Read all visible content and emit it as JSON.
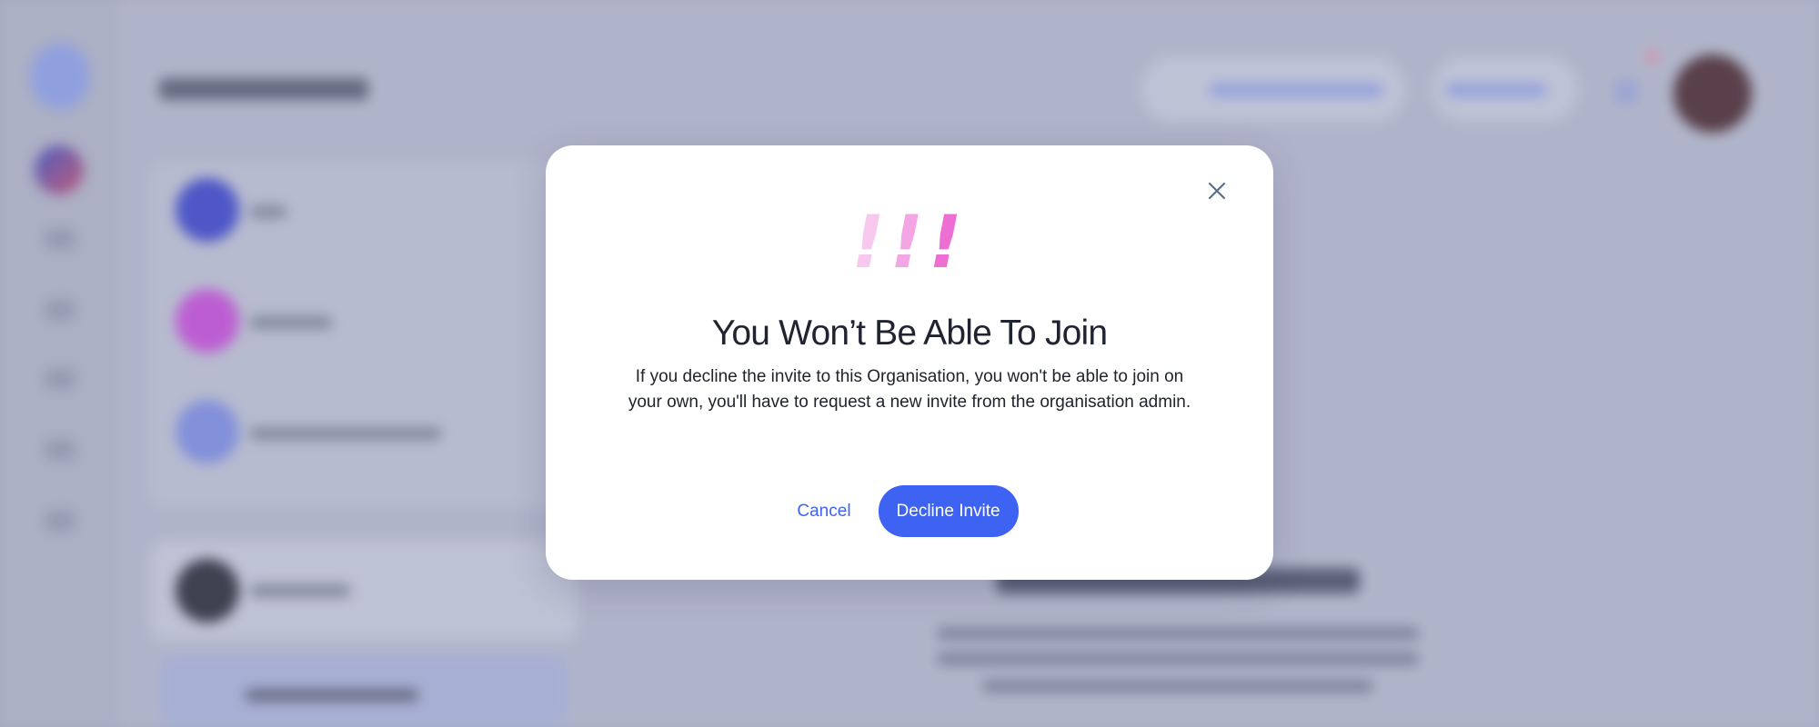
{
  "modal": {
    "warning_glyph": [
      "!",
      "!",
      "!"
    ],
    "title": "You Won’t Be Able To Join",
    "body": "If you decline the invite to this Organisation, you won't be able to join on your own, you'll have to request a new invite from the organisation admin.",
    "cancel_label": "Cancel",
    "decline_label": "Decline Invite",
    "close_icon": "close-icon"
  },
  "colors": {
    "accent": "#3e63f2",
    "title": "#1f2430",
    "warning_gradient": [
      "#f7c9ef",
      "#f4a5e3",
      "#ee6fd3"
    ]
  }
}
